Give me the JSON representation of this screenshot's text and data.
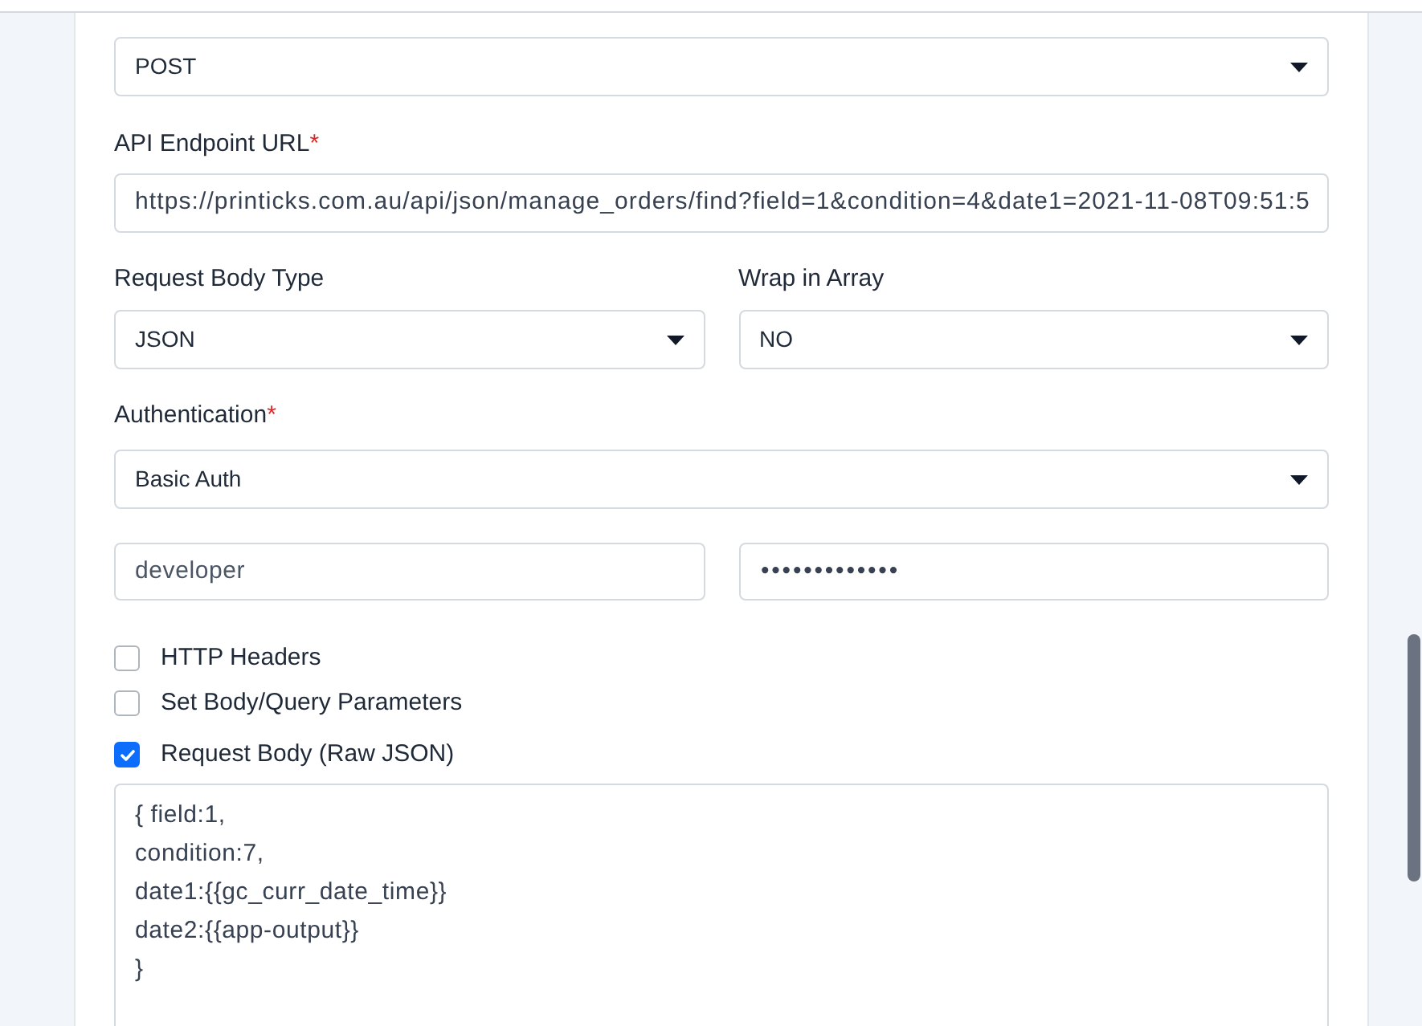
{
  "method": {
    "value": "POST"
  },
  "api_endpoint_url": {
    "label": "API Endpoint URL",
    "required_mark": "*",
    "value": "https://printicks.com.au/api/json/manage_orders/find?field=1&condition=4&date1=2021-11-08T09:51:5"
  },
  "request_body_type": {
    "label": "Request Body Type",
    "value": "JSON"
  },
  "wrap_in_array": {
    "label": "Wrap in Array",
    "value": "NO"
  },
  "authentication": {
    "label": "Authentication",
    "required_mark": "*",
    "value": "Basic Auth"
  },
  "credentials": {
    "username": "developer",
    "password": "•••••••••••••"
  },
  "options": [
    {
      "label": "HTTP Headers",
      "checked": false
    },
    {
      "label": "Set Body/Query Parameters",
      "checked": false
    },
    {
      "label": "Request Body (Raw JSON)",
      "checked": true
    }
  ],
  "raw_body": {
    "value": "{ field:1,\ncondition:7,\ndate1:{{gc_curr_date_time}}\ndate2:{{app-output}}\n}"
  }
}
